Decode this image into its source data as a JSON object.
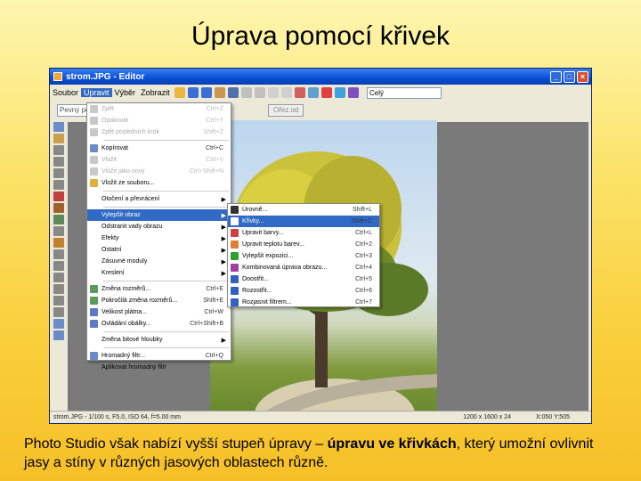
{
  "slide": {
    "title": "Úprava pomocí křivek",
    "caption_1": "Photo Studio však nabízí vyšší stupeň úpravy – ",
    "caption_bold": "úpravu ve křivkách",
    "caption_2": ", který umožní ovlivnit jasy a stíny v různých jasových oblastech různě."
  },
  "window": {
    "title": "strom.JPG - Editor",
    "minimize": "_",
    "maximize": "□",
    "close": "×",
    "menu": [
      "Soubor",
      "Upravit",
      "Výběr",
      "Zobrazit"
    ],
    "combo_value": "Celý",
    "field_left": "Pevný po",
    "button_disabled": "Ořez.od",
    "status": {
      "info": "strom.JPG - 1/100 s, F5.0, ISO 64, f=5.00 mm",
      "size": "1200 x 1600 x 24",
      "pos": "X:050 Y:505"
    }
  },
  "edit_menu": [
    {
      "label": "Zpět",
      "shortcut": "Ctrl+Z",
      "disabled": true,
      "icon_color": "#c8c8c8"
    },
    {
      "label": "Opakovat",
      "shortcut": "Ctrl+Y",
      "disabled": true,
      "icon_color": "#c8c8c8"
    },
    {
      "label": "Zpět posledních krok",
      "shortcut": "Shift+Z",
      "disabled": true,
      "icon_color": "#c8c8c8"
    },
    {
      "sep": true
    },
    {
      "label": "Kopírovat",
      "shortcut": "Ctrl+C",
      "disabled": false,
      "icon_color": "#6a8cc8"
    },
    {
      "label": "Vložit",
      "shortcut": "Ctrl+V",
      "disabled": true,
      "icon_color": "#c8c8c8"
    },
    {
      "label": "Vložit jako nový",
      "shortcut": "Ctrl+Shift+N",
      "disabled": true,
      "icon_color": "#c8c8c8"
    },
    {
      "label": "Vložit ze souboru...",
      "shortcut": "",
      "disabled": false,
      "icon_color": "#e0b040"
    },
    {
      "sep": true
    },
    {
      "label": "Otočení a převrácení",
      "shortcut": "",
      "disabled": false,
      "submenu": true,
      "icon_color": ""
    },
    {
      "sep": true
    },
    {
      "label": "Vylepšit obraz",
      "shortcut": "",
      "disabled": false,
      "submenu": true,
      "selected": true,
      "icon_color": ""
    },
    {
      "label": "Odstranit vady obrazu",
      "shortcut": "",
      "disabled": false,
      "submenu": true,
      "icon_color": ""
    },
    {
      "label": "Efekty",
      "shortcut": "",
      "disabled": false,
      "submenu": true,
      "icon_color": ""
    },
    {
      "label": "Ostatní",
      "shortcut": "",
      "disabled": false,
      "submenu": true,
      "icon_color": ""
    },
    {
      "label": "Zásuvné moduly",
      "shortcut": "",
      "disabled": false,
      "submenu": true,
      "icon_color": ""
    },
    {
      "label": "Kreslení",
      "shortcut": "",
      "disabled": false,
      "submenu": true,
      "icon_color": ""
    },
    {
      "sep": true
    },
    {
      "label": "Změna rozměrů...",
      "shortcut": "Ctrl+E",
      "disabled": false,
      "icon_color": "#5a9a5a"
    },
    {
      "label": "Pokročilá změna rozměrů...",
      "shortcut": "Shift+E",
      "disabled": false,
      "icon_color": "#5a9a5a"
    },
    {
      "label": "Velikost plátna...",
      "shortcut": "Ctrl+W",
      "disabled": false,
      "icon_color": "#5a7ac8"
    },
    {
      "label": "Ovládání obálky...",
      "shortcut": "Ctrl+Shift+B",
      "disabled": false,
      "icon_color": "#5a7ac8"
    },
    {
      "sep": true
    },
    {
      "label": "Změna bitové hloubky",
      "shortcut": "",
      "disabled": false,
      "submenu": true,
      "icon_color": ""
    },
    {
      "sep": true
    },
    {
      "label": "Hromadný filtr...",
      "shortcut": "Ctrl+Q",
      "disabled": false,
      "icon_color": "#6a8cc8"
    },
    {
      "label": "Aplikovat hromadný filtr",
      "shortcut": "",
      "disabled": false,
      "icon_color": ""
    }
  ],
  "submenu": [
    {
      "label": "Úrovně...",
      "shortcut": "Shift+L",
      "icon_color": "#333333"
    },
    {
      "label": "Křivky...",
      "shortcut": "Shift+C",
      "selected": true,
      "icon_color": "#ffffff"
    },
    {
      "label": "Upravit barvy...",
      "shortcut": "Ctrl+L",
      "icon_color": "#d04040"
    },
    {
      "label": "Upravit teplotu barev...",
      "shortcut": "Ctrl+2",
      "icon_color": "#e08030"
    },
    {
      "label": "Vylepšit expozici...",
      "shortcut": "Ctrl+3",
      "icon_color": "#30a030"
    },
    {
      "label": "Kombinovaná úprava obrazu...",
      "shortcut": "Ctrl+4",
      "icon_color": "#a040a0"
    },
    {
      "label": "Doostřit...",
      "shortcut": "Ctrl+5",
      "icon_color": "#3060c0"
    },
    {
      "label": "Rozostřit...",
      "shortcut": "Ctrl+6",
      "icon_color": "#3060c0"
    },
    {
      "label": "Rozjasnit filtrem...",
      "shortcut": "Ctrl+7",
      "icon_color": "#3060c0"
    }
  ]
}
